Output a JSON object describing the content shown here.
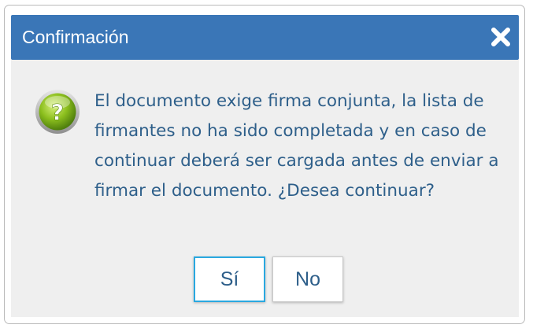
{
  "dialog": {
    "title": "Confirmación",
    "close_icon": "close-icon",
    "message": "El documento exige firma conjunta, la lista de firmantes no ha sido completada y en caso de continuar deberá ser cargada antes de enviar a firmar el documento. ¿Desea continuar?",
    "message_icon": "question-icon",
    "yes_label": "Sí",
    "no_label": "No"
  },
  "colors": {
    "titlebar": "#3a76b7",
    "content_bg": "#efefef",
    "text": "#2e5f8a",
    "focus_border": "#29a8e0",
    "icon_green": "#8cbf1e"
  }
}
